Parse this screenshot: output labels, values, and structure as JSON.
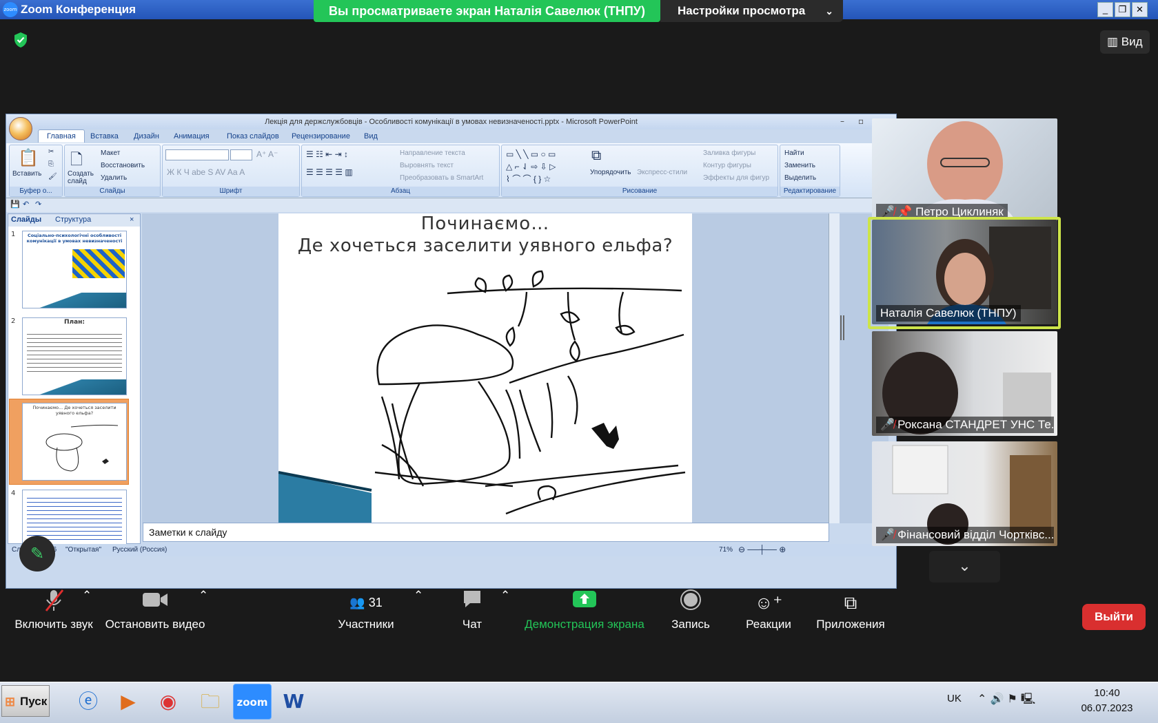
{
  "window": {
    "title": "Zoom Конференция",
    "logo_text": "zoom"
  },
  "share_banner": "Вы просматриваете экран Наталія Савелюк (ТНПУ)",
  "view_settings": "Настройки просмотра",
  "view_button": "Вид",
  "ppt": {
    "title": "Лекція для держслужбовців - Особливості комунікації в умовах невизначеності.pptx - Microsoft PowerPoint",
    "tabs": [
      "Главная",
      "Вставка",
      "Дизайн",
      "Анимация",
      "Показ слайдов",
      "Рецензирование",
      "Вид"
    ],
    "groups": {
      "clipboard": {
        "label": "Буфер о...",
        "paste": "Вставить"
      },
      "slides": {
        "label": "Слайды",
        "new": "Создать слайд",
        "layout": "Макет",
        "reset": "Восстановить",
        "delete": "Удалить"
      },
      "font": {
        "label": "Шрифт"
      },
      "paragraph": {
        "label": "Абзац",
        "direction": "Направление текста",
        "align": "Выровнять текст",
        "smartart": "Преобразовать в SmartArt"
      },
      "drawing": {
        "label": "Рисование",
        "arrange": "Упорядочить",
        "styles": "Экспресс-стили",
        "fill": "Заливка фигуры",
        "outline": "Контур фигуры",
        "effects": "Эффекты для фигур"
      },
      "editing": {
        "label": "Редактирование",
        "find": "Найти",
        "replace": "Заменить",
        "select": "Выделить"
      }
    },
    "panel_tabs": [
      "Слайды",
      "Структура"
    ],
    "thumbs": [
      {
        "num": "1",
        "text": "Соціально-психологічні особливості комунікації в умовах невизначеності"
      },
      {
        "num": "2",
        "text": "План:"
      },
      {
        "num": "3",
        "text": "Починаємо... Де хочеться заселити уявного ельфа?"
      },
      {
        "num": "4",
        "text": ""
      }
    ],
    "slide": {
      "line1": "Починаємо…",
      "line2": "Де хочеться заселити уявного ельфа?"
    },
    "notes": "Заметки к слайду",
    "status": {
      "slide": "Слайд 3 из 16",
      "theme": "\"Открытая\"",
      "lang": "Русский (Россия)",
      "zoom": "71%"
    }
  },
  "participants": [
    {
      "name": "Петро Циклиняк",
      "muted": true,
      "pinned": true
    },
    {
      "name": "Наталія Савелюк (ТНПУ)",
      "muted": false,
      "active": true
    },
    {
      "name": "Роксана СТАНДРЕТ УНС Те...",
      "muted": true
    },
    {
      "name": "Фінансовий відділ Чортківс...",
      "muted": true
    }
  ],
  "toolbar": {
    "audio": "Включить звук",
    "video": "Остановить видео",
    "participants": "Участники",
    "participants_count": "31",
    "chat": "Чат",
    "share": "Демонстрация экрана",
    "record": "Запись",
    "reactions": "Реакции",
    "apps": "Приложения",
    "leave": "Выйти"
  },
  "taskbar": {
    "start": "Пуск",
    "lang": "UK",
    "time": "10:40",
    "date": "06.07.2023"
  },
  "colors": {
    "share_green": "#23c558",
    "leave_red": "#d92f2f",
    "active_border": "#cde44a"
  }
}
